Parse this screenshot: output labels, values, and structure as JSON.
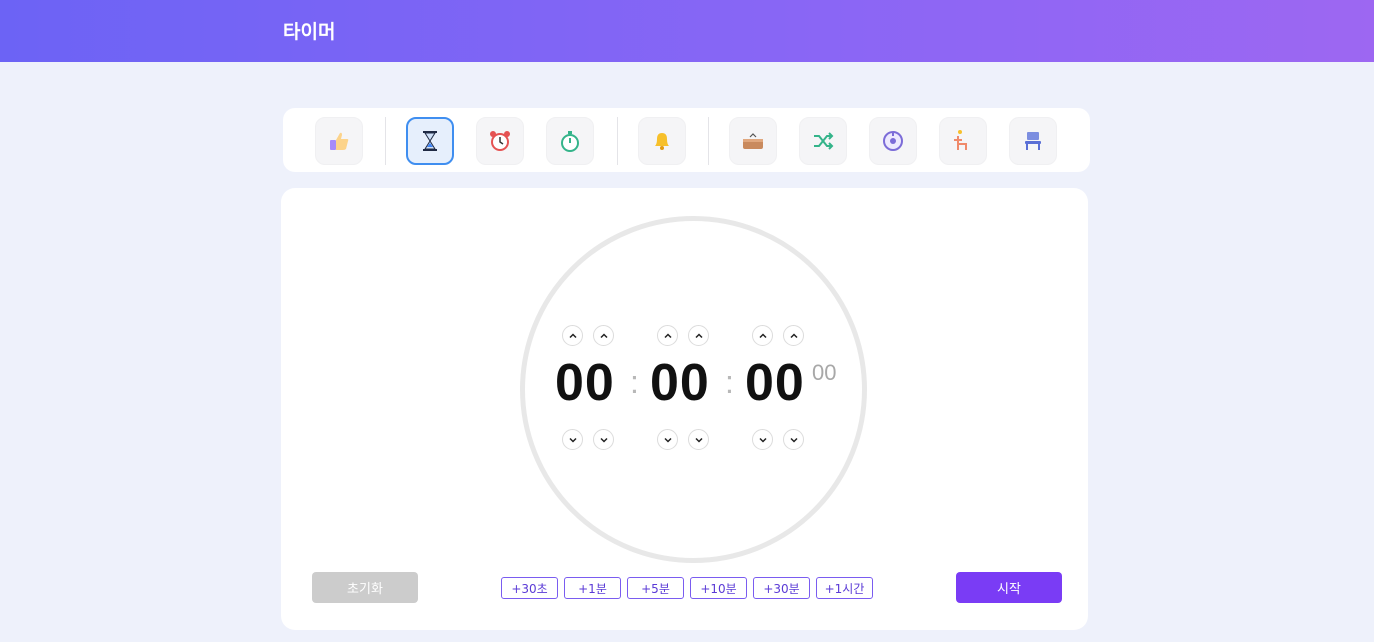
{
  "header": {
    "title": "타이머"
  },
  "toolbar": {
    "items": [
      {
        "name": "thumbs-up-icon",
        "active": false
      },
      {
        "name": "hourglass-icon",
        "active": true
      },
      {
        "name": "alarm-clock-icon",
        "active": false
      },
      {
        "name": "stopwatch-icon",
        "active": false
      },
      {
        "name": "bell-icon",
        "active": false
      },
      {
        "name": "box-icon",
        "active": false
      },
      {
        "name": "shuffle-icon",
        "active": false
      },
      {
        "name": "target-clock-icon",
        "active": false
      },
      {
        "name": "desk-chair-icon",
        "active": false
      },
      {
        "name": "chair-icon",
        "active": false
      }
    ]
  },
  "timer": {
    "hours": "00",
    "minutes": "00",
    "seconds": "00",
    "centiseconds": "00",
    "colon": ":"
  },
  "buttons": {
    "reset": "초기화",
    "start": "시작",
    "quick": [
      "+30초",
      "+1분",
      "+5분",
      "+10분",
      "+30분",
      "+1시간"
    ]
  },
  "colors": {
    "accent": "#7a3cf5",
    "header_start": "#6c63f5",
    "header_end": "#9d67f2",
    "active_tool_border": "#3f8ef0"
  }
}
